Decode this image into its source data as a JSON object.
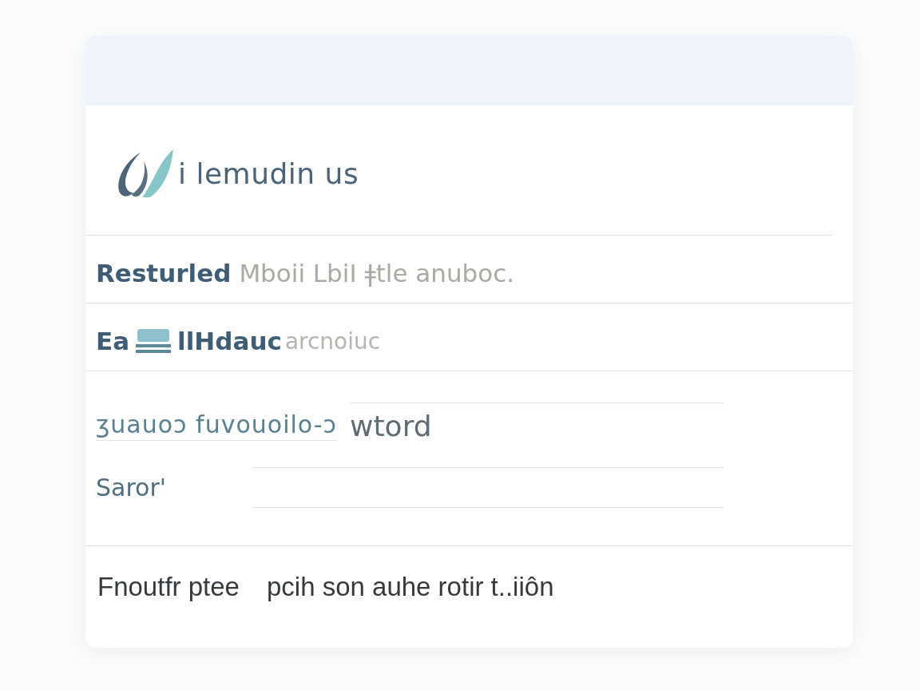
{
  "logo": {
    "text": "i lemudin us"
  },
  "rows": [
    {
      "kind": "title",
      "strong": "Resturled",
      "text": "Mboii LbiI ǂtle anuboc."
    },
    {
      "kind": "title_icon",
      "strong": "Ea",
      "strong_after": "llHdauc",
      "text": "arcnoiuc"
    }
  ],
  "form": {
    "fields": [
      {
        "label": "ʒuauoɔ fuvouoilo-ɔ",
        "value": "wtord"
      },
      {
        "label": "Saror'"
      }
    ]
  },
  "footer": {
    "texts": [
      "Fnoutfr ptee",
      "pcih son auhe rotir t..iiôn"
    ]
  }
}
